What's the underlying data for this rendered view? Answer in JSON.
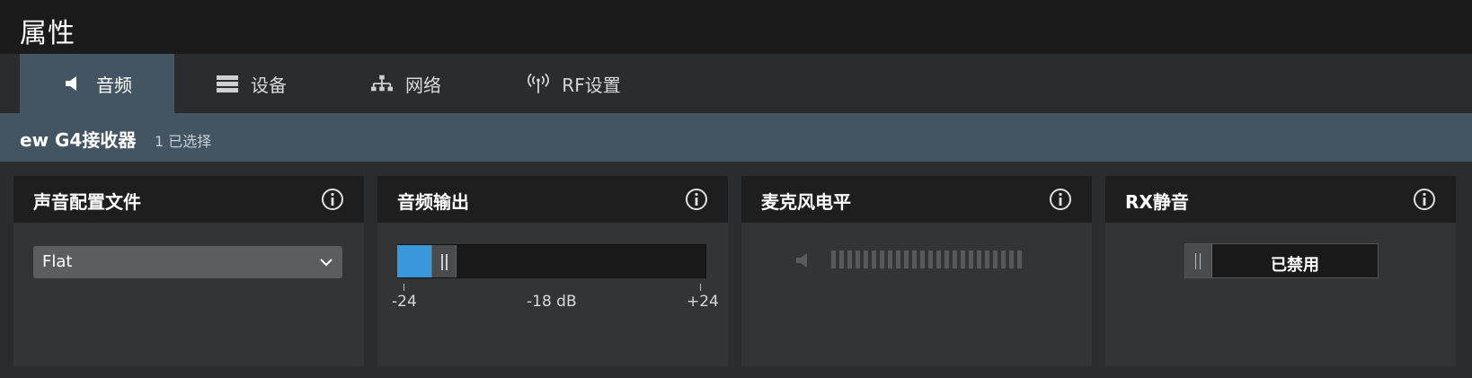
{
  "window": {
    "title": "属性"
  },
  "tabs": [
    {
      "label": "音频",
      "icon": "speaker-icon",
      "active": true
    },
    {
      "label": "设备",
      "icon": "device-rack-icon",
      "active": false
    },
    {
      "label": "网络",
      "icon": "network-icon",
      "active": false
    },
    {
      "label": "RF设置",
      "icon": "antenna-icon",
      "active": false
    }
  ],
  "device": {
    "name": "ew G4接收器",
    "selection": "1 已选择"
  },
  "panels": {
    "sound_profile": {
      "title": "声音配置文件",
      "selected": "Flat"
    },
    "audio_output": {
      "title": "音频输出",
      "value": "-18 dB",
      "value_db": -18,
      "min": "-24",
      "max": "+24",
      "min_db": -24,
      "max_db": 24
    },
    "mic_level": {
      "title": "麦克风电平",
      "level": 0
    },
    "rx_mute": {
      "title": "RX静音",
      "state": "已禁用"
    }
  },
  "colors": {
    "accent": "#3a97d9",
    "tab_active": "#435562",
    "header_bg": "#1b1b1c",
    "panel_bg": "#333436"
  }
}
